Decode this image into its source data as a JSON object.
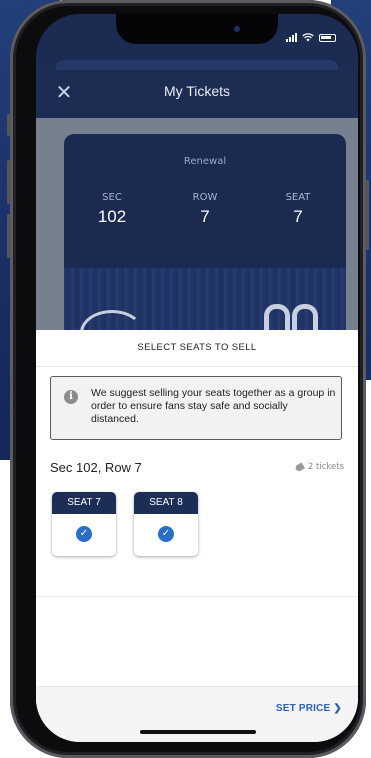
{
  "status_bar": {
    "signal": "signal-icon",
    "wifi": "wifi-icon",
    "battery": "battery-icon"
  },
  "header": {
    "close_icon": "close-icon",
    "title": "My Tickets"
  },
  "ticket": {
    "label": "Renewal",
    "sec_label": "SEC",
    "sec_value": "102",
    "row_label": "ROW",
    "row_value": "7",
    "seat_label": "SEAT",
    "seat_value": "7"
  },
  "sheet": {
    "title": "SELECT SEATS TO SELL",
    "notice": "We suggest selling your seats together as a group in order to ensure fans stay safe and socially distanced.",
    "section_row": "Sec 102, Row 7",
    "tickets_count": "2 tickets",
    "seats": [
      {
        "label": "SEAT 7",
        "selected": true
      },
      {
        "label": "SEAT 8",
        "selected": true
      }
    ],
    "set_price": "SET PRICE ❯"
  },
  "colors": {
    "navy": "#1c2b52",
    "accent": "#2a62b8",
    "check": "#2a6ec9"
  }
}
